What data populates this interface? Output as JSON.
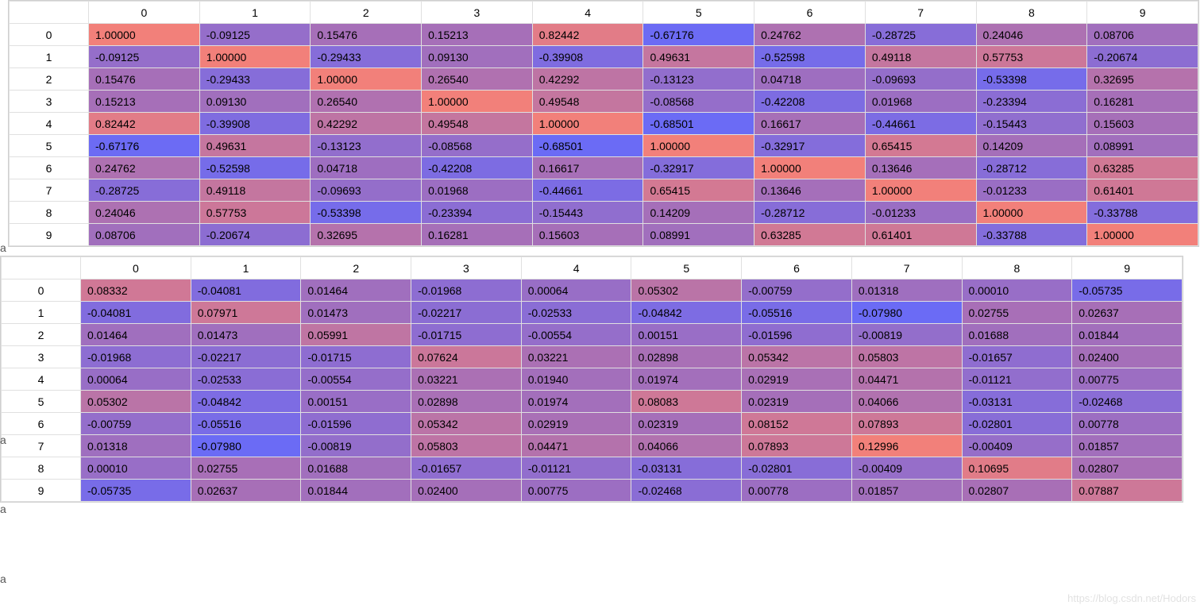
{
  "chart_data": [
    {
      "type": "heatmap",
      "title": "",
      "xlabel": "",
      "ylabel": "",
      "columns": [
        "0",
        "1",
        "2",
        "3",
        "4",
        "5",
        "6",
        "7",
        "8",
        "9"
      ],
      "rows": [
        "0",
        "1",
        "2",
        "3",
        "4",
        "5",
        "6",
        "7",
        "8",
        "9"
      ],
      "values": [
        [
          1.0,
          -0.09125,
          0.15476,
          0.15213,
          0.82442,
          -0.67176,
          0.24762,
          -0.28725,
          0.24046,
          0.08706
        ],
        [
          -0.09125,
          1.0,
          -0.29433,
          0.0913,
          -0.39908,
          0.49631,
          -0.52598,
          0.49118,
          0.57753,
          -0.20674
        ],
        [
          0.15476,
          -0.29433,
          1.0,
          0.2654,
          0.42292,
          -0.13123,
          0.04718,
          -0.09693,
          -0.53398,
          0.32695
        ],
        [
          0.15213,
          0.0913,
          0.2654,
          1.0,
          0.49548,
          -0.08568,
          -0.42208,
          0.01968,
          -0.23394,
          0.16281
        ],
        [
          0.82442,
          -0.39908,
          0.42292,
          0.49548,
          1.0,
          -0.68501,
          0.16617,
          -0.44661,
          -0.15443,
          0.15603
        ],
        [
          -0.67176,
          0.49631,
          -0.13123,
          -0.08568,
          -0.68501,
          1.0,
          -0.32917,
          0.65415,
          0.14209,
          0.08991
        ],
        [
          0.24762,
          -0.52598,
          0.04718,
          -0.42208,
          0.16617,
          -0.32917,
          1.0,
          0.13646,
          -0.28712,
          0.63285
        ],
        [
          -0.28725,
          0.49118,
          -0.09693,
          0.01968,
          -0.44661,
          0.65415,
          0.13646,
          1.0,
          -0.01233,
          0.61401
        ],
        [
          0.24046,
          0.57753,
          -0.53398,
          -0.23394,
          -0.15443,
          0.14209,
          -0.28712,
          -0.01233,
          1.0,
          -0.33788
        ],
        [
          0.08706,
          -0.20674,
          0.32695,
          0.16281,
          0.15603,
          0.08991,
          0.63285,
          0.61401,
          -0.33788,
          1.0
        ]
      ],
      "vmin": -0.68501,
      "vmax": 1.0,
      "decimals": 5
    },
    {
      "type": "heatmap",
      "title": "",
      "xlabel": "",
      "ylabel": "",
      "columns": [
        "0",
        "1",
        "2",
        "3",
        "4",
        "5",
        "6",
        "7",
        "8",
        "9"
      ],
      "rows": [
        "0",
        "1",
        "2",
        "3",
        "4",
        "5",
        "6",
        "7",
        "8",
        "9"
      ],
      "values": [
        [
          0.08332,
          -0.04081,
          0.01464,
          -0.01968,
          0.00064,
          0.05302,
          -0.00759,
          0.01318,
          0.0001,
          -0.05735
        ],
        [
          -0.04081,
          0.07971,
          0.01473,
          -0.02217,
          -0.02533,
          -0.04842,
          -0.05516,
          -0.0798,
          0.02755,
          0.02637
        ],
        [
          0.01464,
          0.01473,
          0.05991,
          -0.01715,
          -0.00554,
          0.00151,
          -0.01596,
          -0.00819,
          0.01688,
          0.01844
        ],
        [
          -0.01968,
          -0.02217,
          -0.01715,
          0.07624,
          0.03221,
          0.02898,
          0.05342,
          0.05803,
          -0.01657,
          0.024
        ],
        [
          0.00064,
          -0.02533,
          -0.00554,
          0.03221,
          0.0194,
          0.01974,
          0.02919,
          0.04471,
          -0.01121,
          0.00775
        ],
        [
          0.05302,
          -0.04842,
          0.00151,
          0.02898,
          0.01974,
          0.08083,
          0.02319,
          0.04066,
          -0.03131,
          -0.02468
        ],
        [
          -0.00759,
          -0.05516,
          -0.01596,
          0.05342,
          0.02919,
          0.02319,
          0.08152,
          0.07893,
          -0.02801,
          0.00778
        ],
        [
          0.01318,
          -0.0798,
          -0.00819,
          0.05803,
          0.04471,
          0.04066,
          0.07893,
          0.12996,
          -0.00409,
          0.01857
        ],
        [
          0.0001,
          0.02755,
          0.01688,
          -0.01657,
          -0.01121,
          -0.03131,
          -0.02801,
          -0.00409,
          0.10695,
          0.02807
        ],
        [
          -0.05735,
          0.02637,
          0.01844,
          0.024,
          0.00775,
          -0.02468,
          0.00778,
          0.01857,
          0.02807,
          0.07887
        ]
      ],
      "vmin": -0.0798,
      "vmax": 0.12996,
      "decimals": 5
    }
  ],
  "watermark": "https://blog.csdn.net/Hodors",
  "edge_letters": [
    "a",
    "a",
    "a",
    "a"
  ]
}
